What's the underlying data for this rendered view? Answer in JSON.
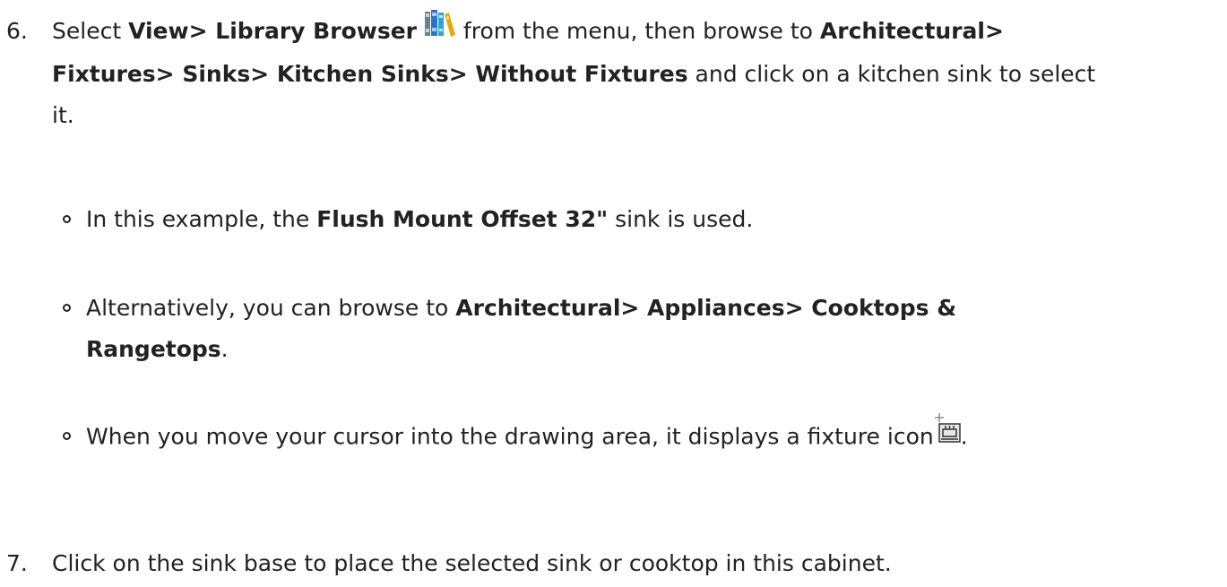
{
  "steps": [
    {
      "number": "6.",
      "select_prefix": "Select ",
      "menu_path": "View> Library Browser",
      "icon": "library-browser-icon",
      "from_menu": " from the menu, then browse to ",
      "browse_path_1": "Architectural>",
      "browse_path_2": "Fixtures> Sinks> Kitchen Sinks> Without Fixtures",
      "click_text_1": " and click on a kitchen sink to select",
      "click_text_2": "it.",
      "subitems": [
        {
          "prefix": "In this example, the ",
          "bold": "Flush Mount Offset 32\"",
          "suffix": " sink is used."
        },
        {
          "prefix": "Alternatively, you can browse to ",
          "bold_1": "Architectural> Appliances> Cooktops &",
          "bold_2": "Rangetops",
          "suffix": "."
        },
        {
          "text": "When you move your cursor into the drawing area, it displays a fixture icon",
          "icon": "fixture-cursor-icon",
          "suffix": "."
        }
      ]
    },
    {
      "number": "7.",
      "text": "Click on the sink base to place the selected sink or cooktop in this cabinet."
    }
  ],
  "colors": {
    "text": "#222222",
    "background": "#ffffff"
  }
}
